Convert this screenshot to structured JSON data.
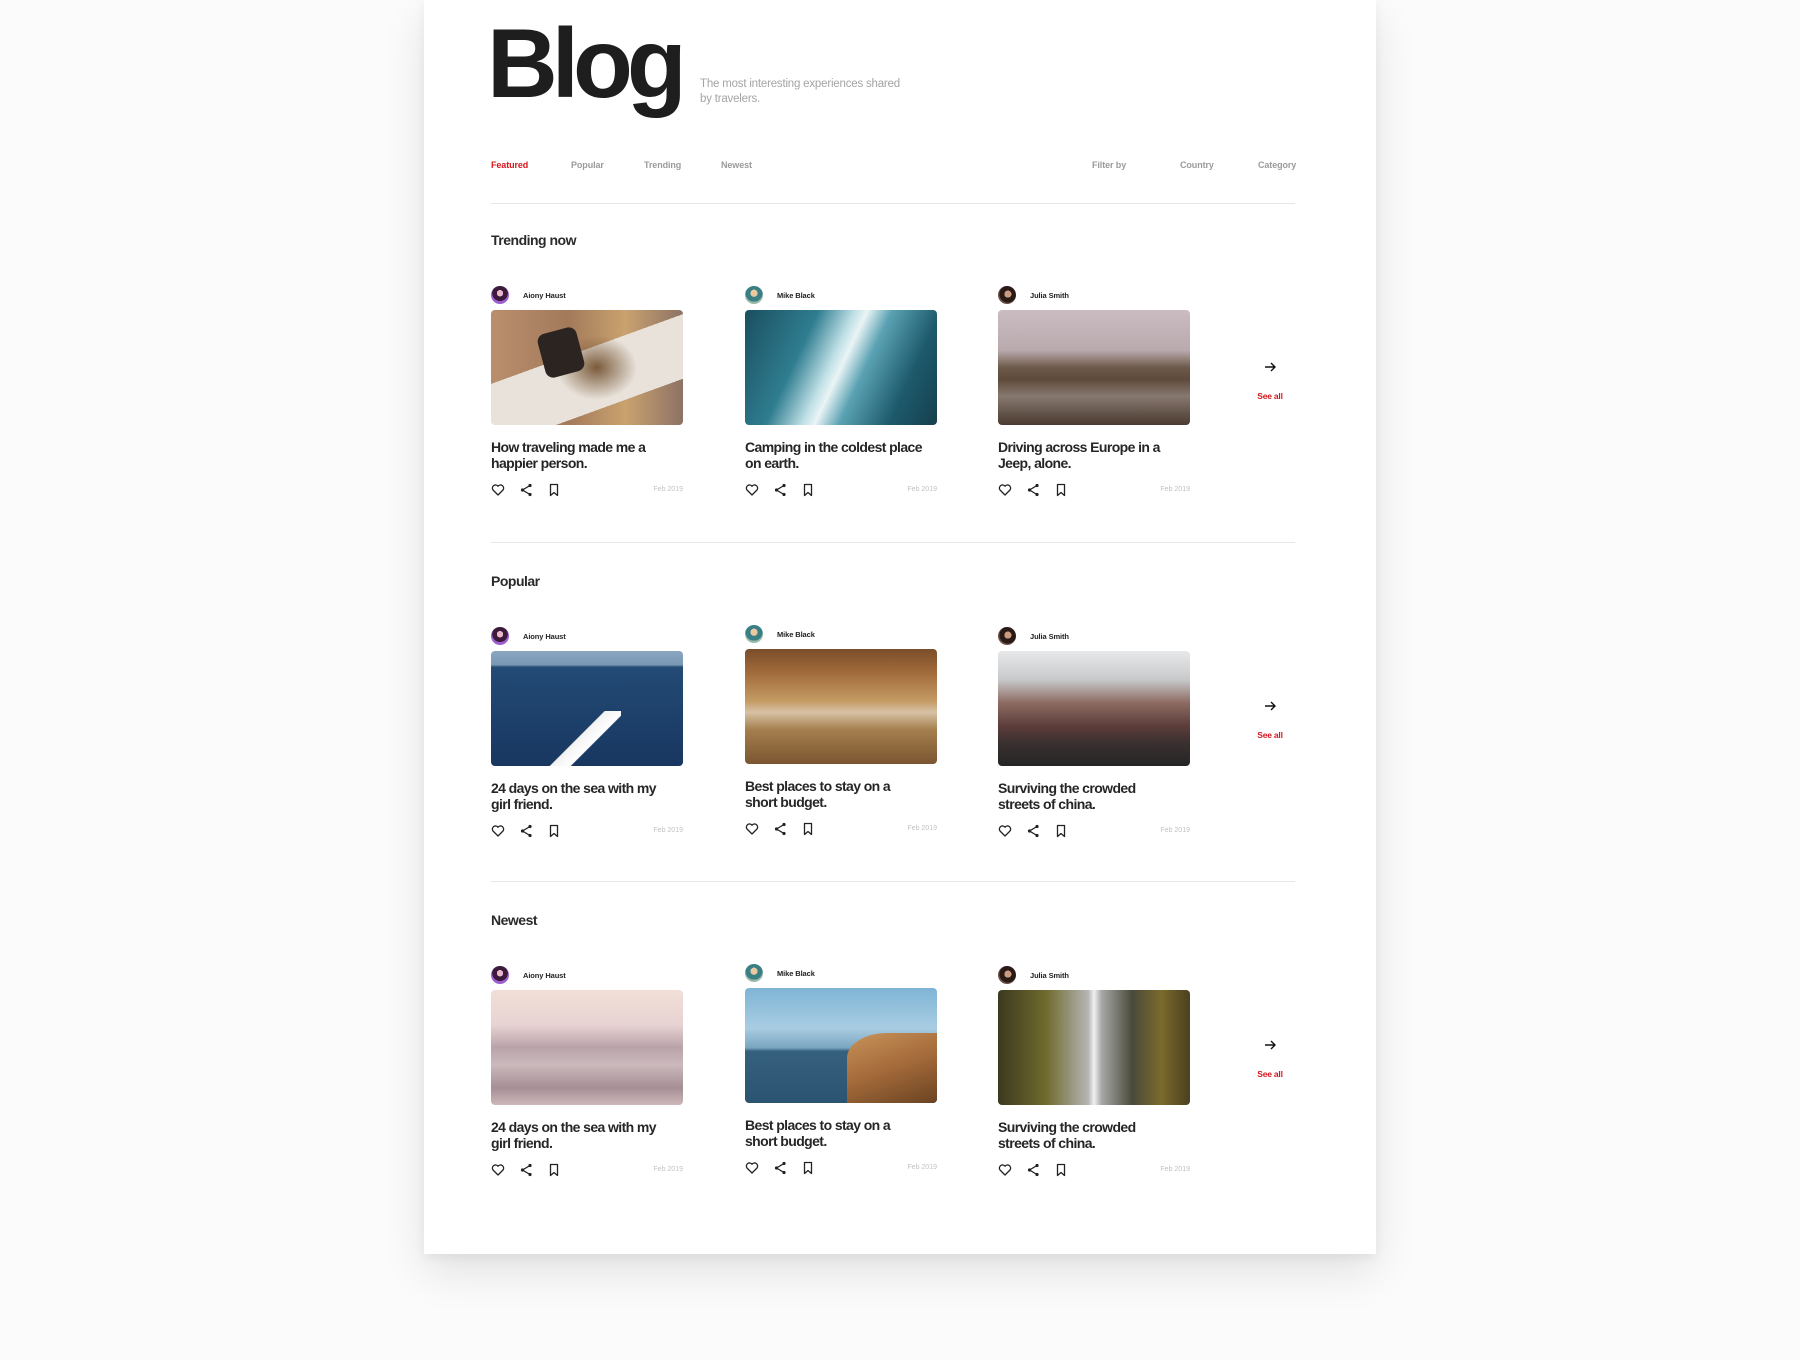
{
  "header": {
    "title": "Blog",
    "subtitle": "The most interesting experiences shared by travelers."
  },
  "nav": {
    "tabs": [
      {
        "label": "Featured",
        "active": true
      },
      {
        "label": "Popular",
        "active": false
      },
      {
        "label": "Trending",
        "active": false
      },
      {
        "label": "Newest",
        "active": false
      }
    ],
    "filter_label": "Filter by",
    "filters": [
      "Country",
      "Category"
    ]
  },
  "colors": {
    "accent": "#d8141d",
    "text": "#222222",
    "muted": "#9b9b9b"
  },
  "sections": [
    {
      "title": "Trending now",
      "see_all": "See all",
      "posts": [
        {
          "author": "Aiony Haust",
          "title": "How traveling made me a happier person.",
          "date": "Feb 2019",
          "image": "woman-sunbathing-photo"
        },
        {
          "author": "Mike Black",
          "title": "Camping in the coldest place on earth.",
          "date": "Feb 2019",
          "image": "ice-cave-photo"
        },
        {
          "author": "Julia Smith",
          "title": "Driving across Europe in a Jeep, alone.",
          "date": "Feb 2019",
          "image": "jeep-road-photo"
        }
      ]
    },
    {
      "title": "Popular",
      "see_all": "See all",
      "posts": [
        {
          "author": "Aiony Haust",
          "title": "24 days on the sea with my girl friend.",
          "date": "Feb 2019",
          "image": "boat-sea-photo"
        },
        {
          "author": "Mike Black",
          "title": "Best places to stay on a short budget.",
          "date": "Feb 2019",
          "image": "woman-on-wall-photo"
        },
        {
          "author": "Julia Smith",
          "title": "Surviving the crowded streets of china.",
          "date": "Feb 2019",
          "image": "crowded-street-photo"
        }
      ]
    },
    {
      "title": "Newest",
      "see_all": "See all",
      "posts": [
        {
          "author": "Aiony Haust",
          "title": "24 days on the sea with my girl friend.",
          "date": "Feb 2019",
          "image": "snowy-hills-photo"
        },
        {
          "author": "Mike Black",
          "title": "Best places to stay on a short budget.",
          "date": "Feb 2019",
          "image": "lighthouse-cliff-photo"
        },
        {
          "author": "Julia Smith",
          "title": "Surviving the crowded streets of china.",
          "date": "Feb 2019",
          "image": "waterfall-photo"
        }
      ]
    }
  ],
  "icons": {
    "like": "heart-icon",
    "share": "share-icon",
    "save": "bookmark-icon",
    "see_all_arrow": "arrow-right-icon"
  }
}
